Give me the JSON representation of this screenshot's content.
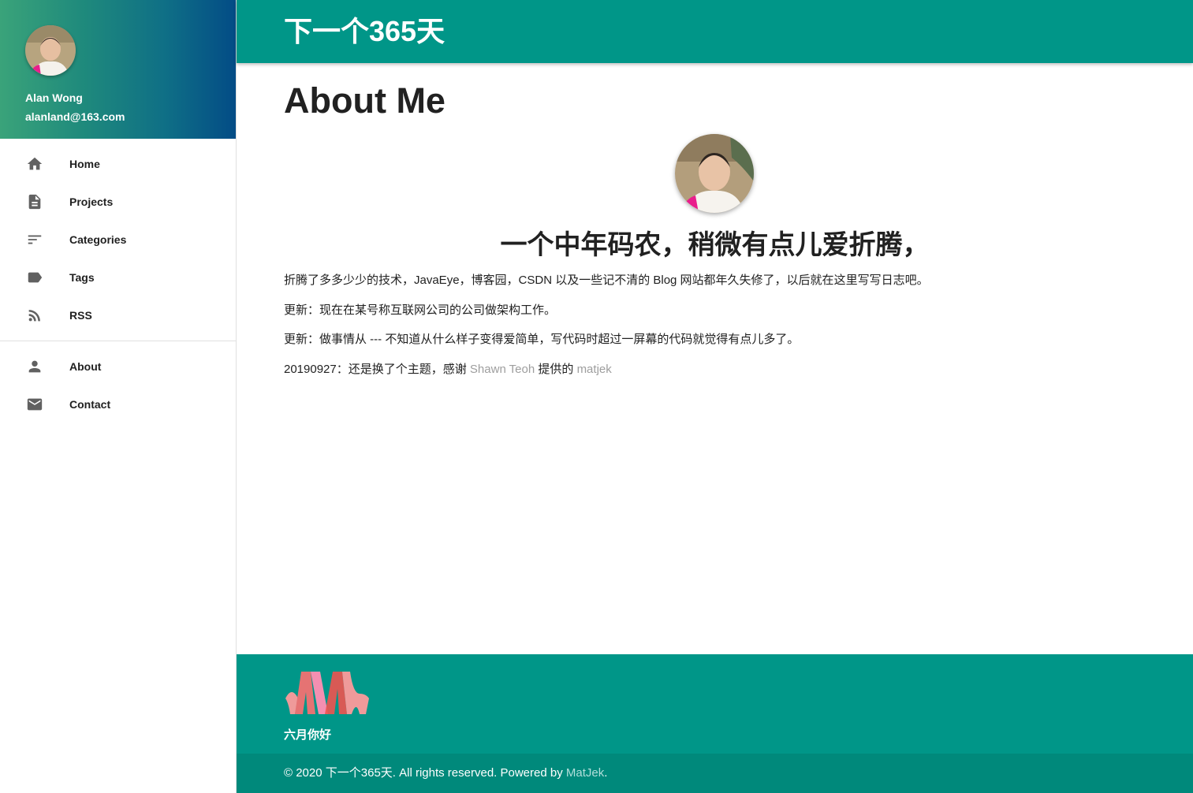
{
  "sidebar": {
    "name": "Alan Wong",
    "email": "alanland@163.com",
    "items": [
      {
        "label": "Home",
        "icon": "home-icon"
      },
      {
        "label": "Projects",
        "icon": "document-icon"
      },
      {
        "label": "Categories",
        "icon": "sort-icon"
      },
      {
        "label": "Tags",
        "icon": "label-icon"
      },
      {
        "label": "RSS",
        "icon": "rss-icon"
      }
    ],
    "secondary_items": [
      {
        "label": "About",
        "icon": "person-icon"
      },
      {
        "label": "Contact",
        "icon": "mail-icon"
      }
    ]
  },
  "appbar": {
    "title": "下一个365天"
  },
  "main": {
    "title": "About Me",
    "headline": "一个中年码农，稍微有点儿爱折腾，",
    "para1": "折腾了多多少少的技术，JavaEye，博客园，CSDN 以及一些记不清的 Blog 网站都年久失修了，以后就在这里写写日志吧。",
    "para2": "更新：现在在某号称互联网公司的公司做架构工作。",
    "para3": "更新：做事情从 --- 不知道从什么样子变得爱简单，写代码时超过一屏幕的代码就觉得有点儿多了。",
    "para4_prefix": "20190927：还是换了个主题，感谢 ",
    "para4_link1": "Shawn Teoh",
    "para4_mid": " 提供的 ",
    "para4_link2": "matjek"
  },
  "footer": {
    "tagline": "六月你好",
    "copyright_prefix": "© 2020 下一个365天. All rights reserved. Powered by ",
    "copyright_link": "MatJek",
    "copyright_suffix": "."
  },
  "colors": {
    "primary": "#009688",
    "footer_bottom": "#00897b",
    "link": "#9e9e9e"
  }
}
